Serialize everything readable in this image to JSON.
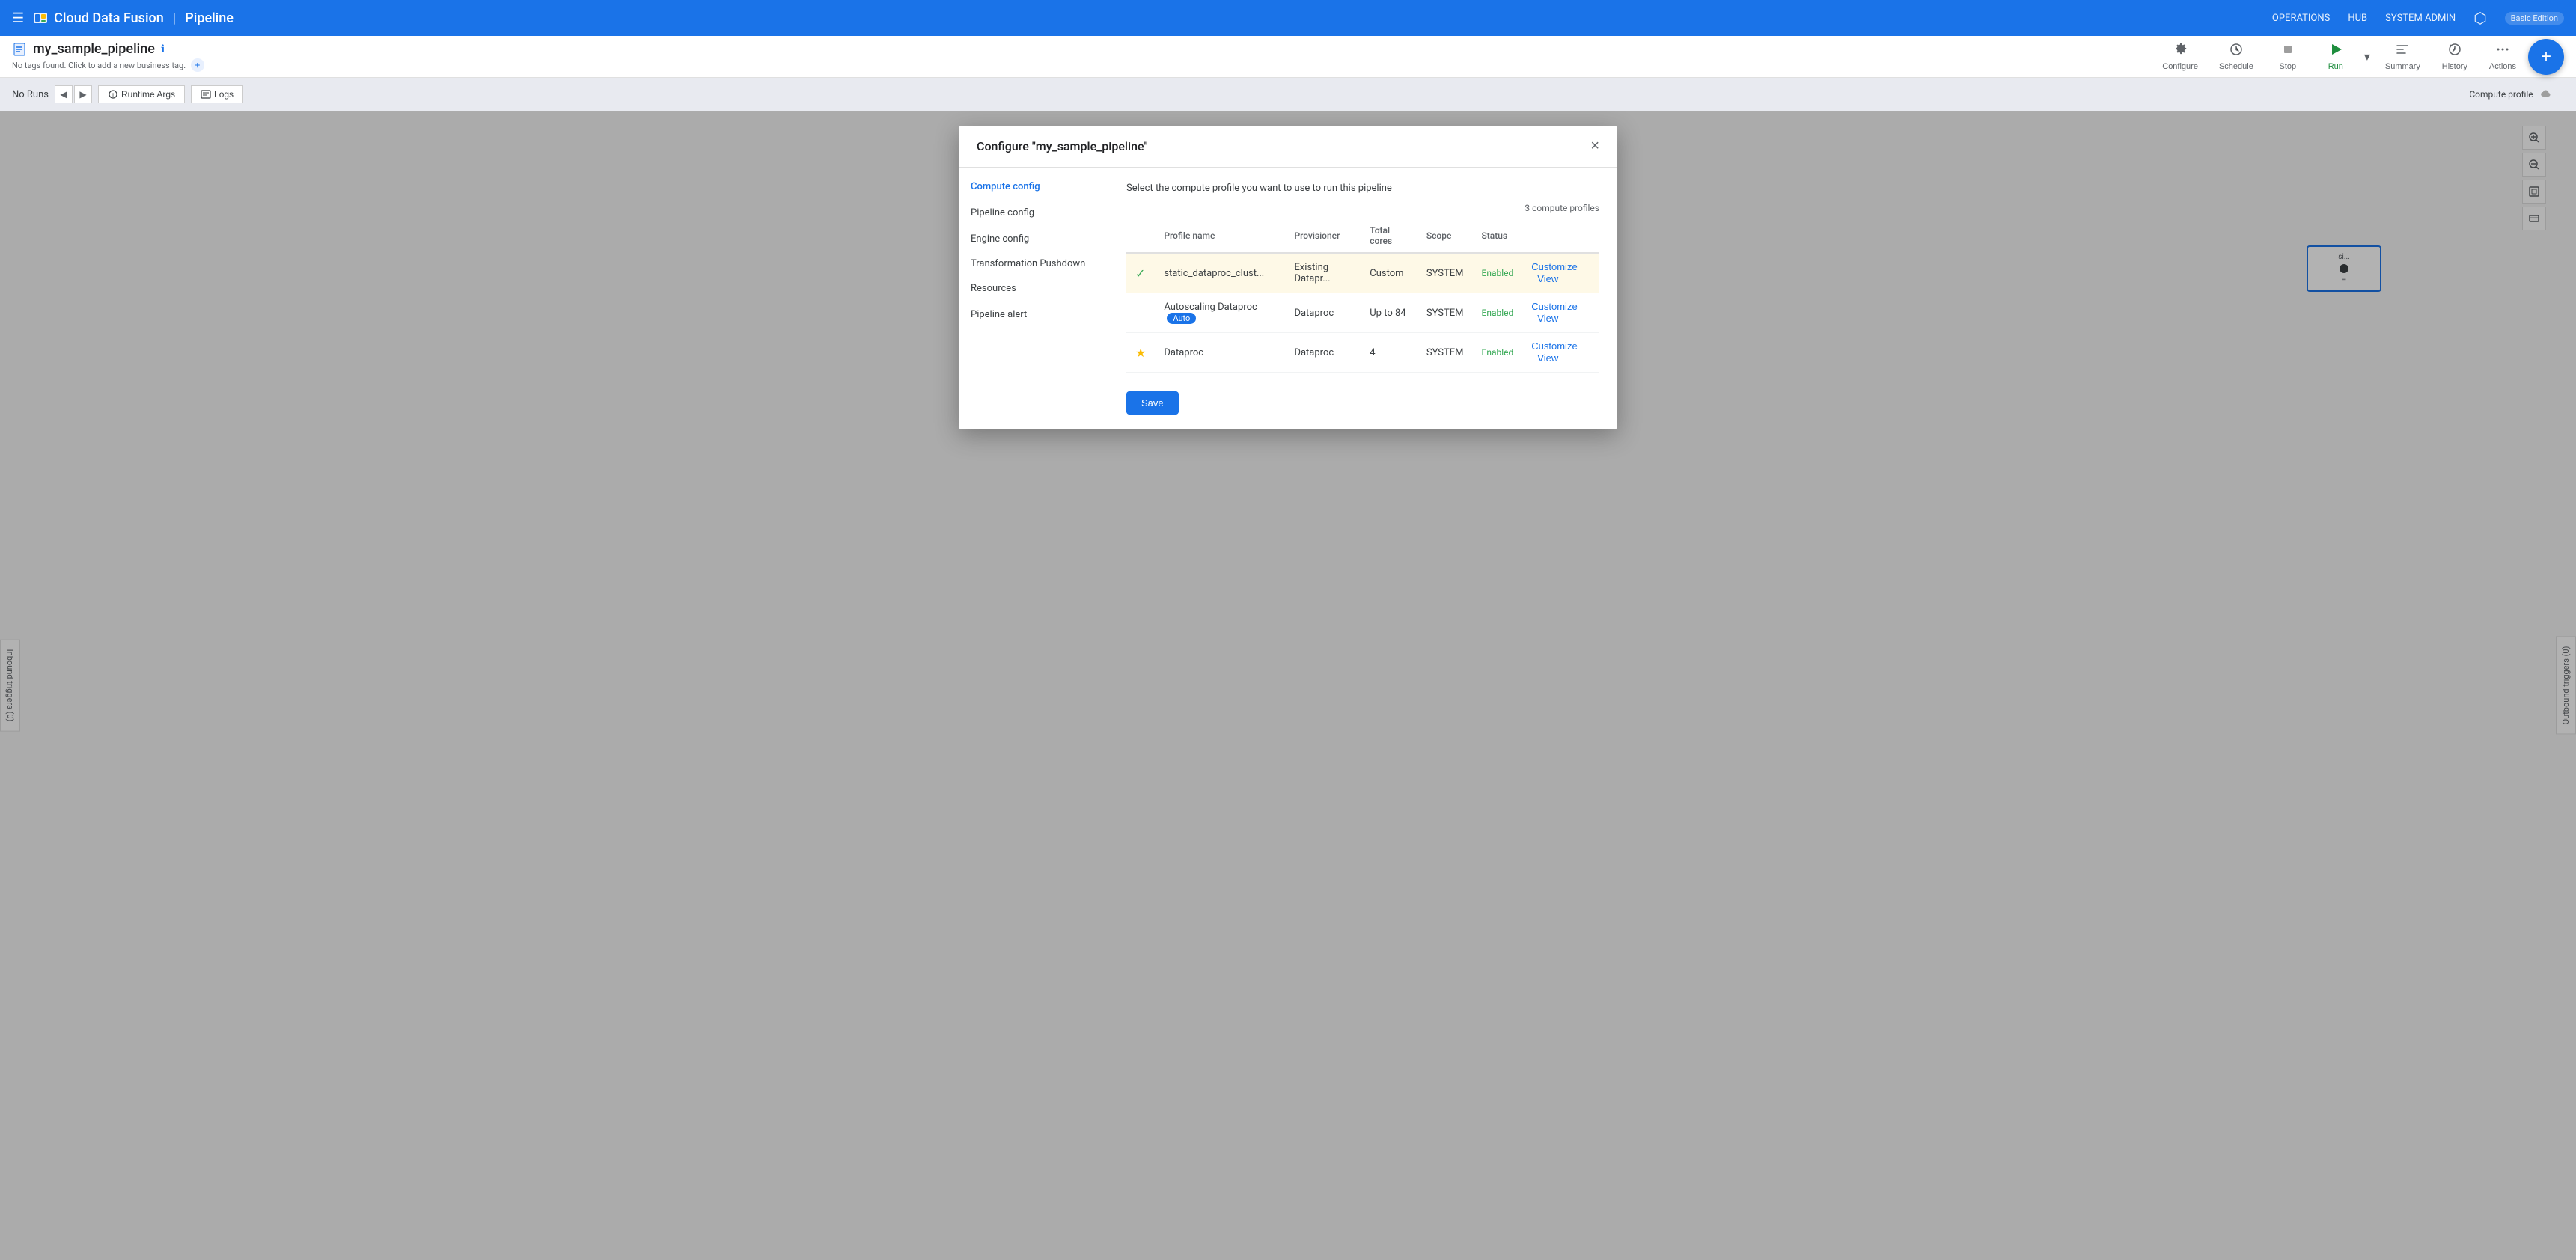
{
  "app": {
    "brand": "Cloud Data Fusion",
    "separator": "|",
    "pipeline_label": "Pipeline",
    "hamburger_icon": "☰"
  },
  "top_nav": {
    "operations": "OPERATIONS",
    "hub": "HUB",
    "system_admin": "SYSTEM ADMIN",
    "network_icon": "⬡",
    "edition": "Basic Edition"
  },
  "pipeline_bar": {
    "pipeline_name": "my_sample_pipeline",
    "info_icon": "ℹ",
    "tag_text": "No tags found. Click to add a new business tag.",
    "tag_add": "+"
  },
  "toolbar": {
    "configure_label": "Configure",
    "schedule_label": "Schedule",
    "stop_label": "Stop",
    "run_label": "Run",
    "summary_label": "Summary",
    "history_label": "History",
    "actions_label": "Actions",
    "fab_label": "+"
  },
  "sub_bar": {
    "no_runs": "No Runs",
    "runtime_args": "Runtime Args",
    "logs": "Logs",
    "compute_profile_label": "Compute profile"
  },
  "modal": {
    "title": "Configure \"my_sample_pipeline\"",
    "close_icon": "×",
    "description": "Select the compute profile you want to use to run this pipeline",
    "profiles_count": "3 compute profiles",
    "nav_items": [
      {
        "label": "Compute config",
        "active": true
      },
      {
        "label": "Pipeline config",
        "active": false
      },
      {
        "label": "Engine config",
        "active": false
      },
      {
        "label": "Transformation Pushdown",
        "active": false
      },
      {
        "label": "Resources",
        "active": false
      },
      {
        "label": "Pipeline alert",
        "active": false
      }
    ],
    "table": {
      "columns": [
        "Profile name",
        "Provisioner",
        "Total cores",
        "Scope",
        "Status"
      ],
      "rows": [
        {
          "selected": true,
          "icon": "check",
          "name": "static_dataproc_clust...",
          "provisioner": "Existing Datapr...",
          "cores": "Custom",
          "scope": "SYSTEM",
          "status": "Enabled",
          "auto_badge": false
        },
        {
          "selected": false,
          "icon": "none",
          "name": "Autoscaling Dataproc",
          "provisioner": "Dataproc",
          "cores": "Up to 84",
          "scope": "SYSTEM",
          "status": "Enabled",
          "auto_badge": true
        },
        {
          "selected": false,
          "icon": "star",
          "name": "Dataproc",
          "provisioner": "Dataproc",
          "cores": "4",
          "scope": "SYSTEM",
          "status": "Enabled",
          "auto_badge": false
        }
      ]
    },
    "save_label": "Save"
  },
  "triggers": {
    "inbound": "Inbound triggers (0)",
    "outbound": "Outbound triggers (0)"
  },
  "canvas_tools": {
    "zoom_in": "+",
    "zoom_out": "−",
    "fit": "⊡",
    "mini_map": "⬜"
  }
}
